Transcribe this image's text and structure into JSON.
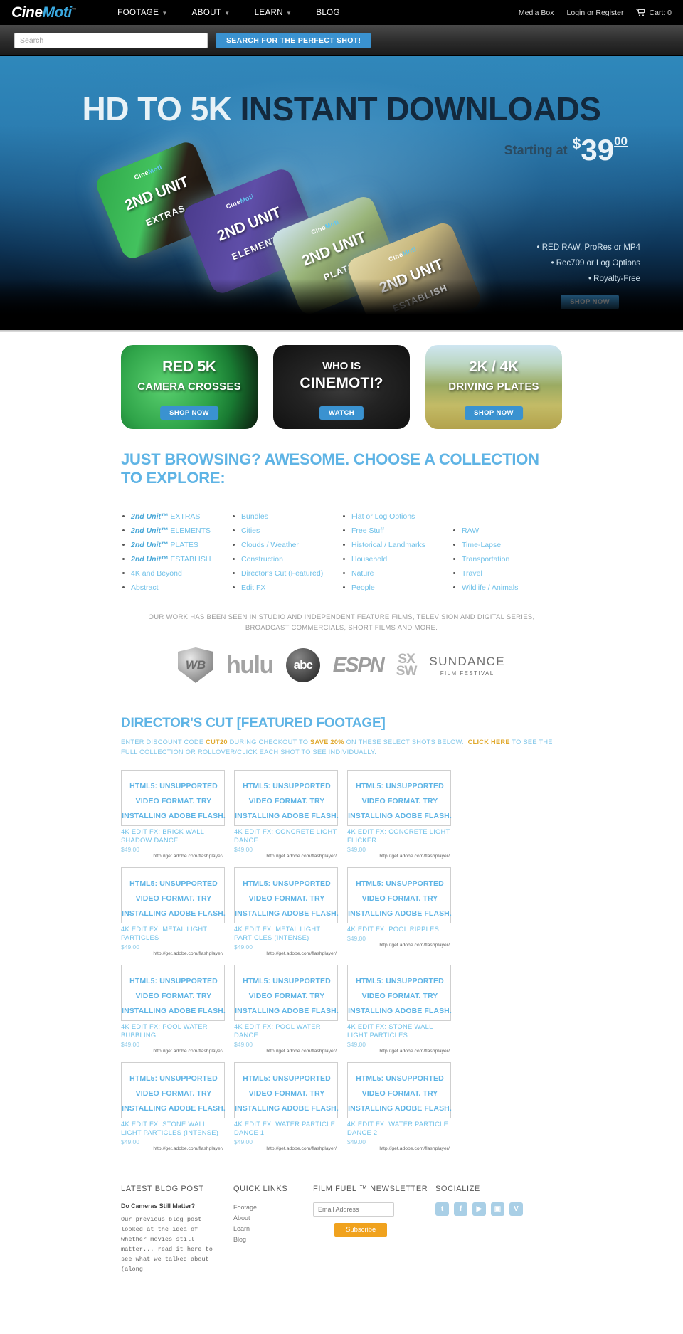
{
  "brand": {
    "part1": "Cine",
    "part2": "Moti",
    "tm": "™"
  },
  "nav": {
    "items": [
      {
        "label": "FOOTAGE",
        "has_caret": true
      },
      {
        "label": "ABOUT",
        "has_caret": true
      },
      {
        "label": "LEARN",
        "has_caret": true
      },
      {
        "label": "BLOG",
        "has_caret": false
      }
    ],
    "media_box": "Media Box",
    "login": "Login or Register",
    "cart": "Cart: 0"
  },
  "search": {
    "placeholder": "Search",
    "value": "",
    "button": "SEARCH FOR THE PERFECT SHOT!"
  },
  "hero": {
    "title_light": "HD TO 5K ",
    "title_dark": "INSTANT DOWNLOADS",
    "starting_at": "Starting at",
    "currency": "$",
    "price": "39",
    "cents": "00",
    "bullets": [
      "• RED RAW, ProRes or MP4",
      "• Rec709 or Log Options",
      "• Royalty-Free"
    ],
    "shop_now": "SHOP NOW",
    "cards": [
      {
        "brand1": "Cine",
        "brand2": "Moti",
        "line1": "2ND UNIT",
        "line2": "EXTRAS"
      },
      {
        "brand1": "Cine",
        "brand2": "Moti",
        "line1": "2ND UNIT",
        "line2": "ELEMENTS"
      },
      {
        "brand1": "Cine",
        "brand2": "Moti",
        "line1": "2ND UNIT",
        "line2": "PLATES"
      },
      {
        "brand1": "Cine",
        "brand2": "Moti",
        "line1": "2ND UNIT",
        "line2": "ESTABLISH"
      }
    ]
  },
  "promos": [
    {
      "title": "RED 5K",
      "sub": "CAMERA CROSSES",
      "button": "SHOP NOW",
      "style": "green"
    },
    {
      "title": "WHO IS",
      "sub": "CINEMOTI?",
      "button": "WATCH",
      "style": "dark"
    },
    {
      "title": "2K / 4K",
      "sub": "DRIVING PLATES",
      "button": "SHOP NOW",
      "style": "field"
    }
  ],
  "browse": {
    "heading": "JUST BROWSING? AWESOME. CHOOSE A COLLECTION TO EXPLORE:",
    "columns": [
      [
        {
          "unit": "2nd Unit™",
          "rest": " EXTRAS"
        },
        {
          "unit": "2nd Unit™",
          "rest": " ELEMENTS"
        },
        {
          "unit": "2nd Unit™",
          "rest": " PLATES"
        },
        {
          "unit": "2nd Unit™",
          "rest": " ESTABLISH"
        },
        {
          "unit": "",
          "rest": "4K and Beyond"
        },
        {
          "unit": "",
          "rest": "Abstract"
        }
      ],
      [
        {
          "unit": "",
          "rest": "Bundles"
        },
        {
          "unit": "",
          "rest": "Cities"
        },
        {
          "unit": "",
          "rest": "Clouds / Weather"
        },
        {
          "unit": "",
          "rest": "Construction"
        },
        {
          "unit": "",
          "rest": "Director's Cut (Featured)"
        },
        {
          "unit": "",
          "rest": "Edit FX"
        }
      ],
      [
        {
          "unit": "",
          "rest": "Flat or Log Options"
        },
        {
          "unit": "",
          "rest": "Free Stuff"
        },
        {
          "unit": "",
          "rest": "Historical / Landmarks"
        },
        {
          "unit": "",
          "rest": "Household"
        },
        {
          "unit": "",
          "rest": "Nature"
        },
        {
          "unit": "",
          "rest": "People"
        }
      ],
      [
        {
          "unit": "",
          "rest": "RAW"
        },
        {
          "unit": "",
          "rest": "Time-Lapse"
        },
        {
          "unit": "",
          "rest": "Transportation"
        },
        {
          "unit": "",
          "rest": "Travel"
        },
        {
          "unit": "",
          "rest": "Wildlife / Animals"
        }
      ]
    ]
  },
  "seen_in": {
    "text": "OUR WORK HAS BEEN SEEN IN STUDIO AND INDEPENDENT FEATURE FILMS, TELEVISION AND DIGITAL SERIES, BROADCAST COMMERCIALS, SHORT FILMS AND MORE.",
    "logos": [
      {
        "name": "warner-bros-tv",
        "text": "WB"
      },
      {
        "name": "hulu",
        "text": "hulu"
      },
      {
        "name": "abc",
        "text": "abc"
      },
      {
        "name": "espn",
        "text": "ESPN"
      },
      {
        "name": "sxsw",
        "line1": "SX",
        "line2": "SW"
      },
      {
        "name": "sundance",
        "line1": "SUNDANCE",
        "line2": "FILM FESTIVAL"
      }
    ]
  },
  "directors_cut": {
    "heading": "DIRECTOR'S CUT [FEATURED FOOTAGE]",
    "sub_a": "ENTER DISCOUNT CODE ",
    "code": "CUT20",
    "sub_b": " DURING CHECKOUT TO ",
    "save": "SAVE 20%",
    "sub_c": " ON THESE SELECT SHOTS BELOW.  ",
    "click_here": "CLICK HERE",
    "sub_d": " TO SEE THE FULL COLLECTION OR ROLLOVER/CLICK EACH SHOT TO SEE INDIVIDUALLY.",
    "fallback_message": "HTML5: UNSUPPORTED VIDEO FORMAT. TRY INSTALLING ADOBE FLASH.",
    "fallback_url": "http://get.adobe.com/flashplayer/",
    "items": [
      {
        "title": "4K EDIT FX: BRICK WALL SHADOW DANCE",
        "price": "$49.00"
      },
      {
        "title": "4K EDIT FX: CONCRETE LIGHT DANCE",
        "price": "$49.00"
      },
      {
        "title": "4K EDIT FX: CONCRETE LIGHT FLICKER",
        "price": "$49.00"
      },
      {
        "title": "4K EDIT FX: METAL LIGHT PARTICLES",
        "price": "$49.00"
      },
      {
        "title": "4K EDIT FX: METAL LIGHT PARTICLES (INTENSE)",
        "price": "$49.00"
      },
      {
        "title": "4K EDIT FX: POOL RIPPLES",
        "price": "$49.00"
      },
      {
        "title": "4K EDIT FX: POOL WATER BUBBLING",
        "price": "$49.00"
      },
      {
        "title": "4K EDIT FX: POOL WATER DANCE",
        "price": "$49.00"
      },
      {
        "title": "4K EDIT FX: STONE WALL LIGHT PARTICLES",
        "price": "$49.00"
      },
      {
        "title": "4K EDIT FX: STONE WALL LIGHT PARTICLES (INTENSE)",
        "price": "$49.00"
      },
      {
        "title": "4K EDIT FX: WATER PARTICLE DANCE 1",
        "price": "$49.00"
      },
      {
        "title": "4K EDIT FX: WATER PARTICLE DANCE 2",
        "price": "$49.00"
      }
    ]
  },
  "footer": {
    "blog_heading": "LATEST BLOG POST",
    "blog_title": "Do Cameras Still Matter?",
    "blog_body": "Our previous blog post looked at the idea of whether movies still matter... read it here to see what we talked about (along",
    "quick_heading": "QUICK LINKS",
    "quick_links": [
      "Footage",
      "About",
      "Learn",
      "Blog"
    ],
    "news_heading": "FILM FUEL ™ NEWSLETTER",
    "news_placeholder": "Email Address",
    "news_value": "",
    "subscribe": "Subscribe",
    "social_heading": "SOCIALIZE",
    "socials": [
      {
        "name": "twitter-icon",
        "glyph": "t"
      },
      {
        "name": "facebook-icon",
        "glyph": "f"
      },
      {
        "name": "youtube-icon",
        "glyph": "▶"
      },
      {
        "name": "instagram-icon",
        "glyph": "▣"
      },
      {
        "name": "vimeo-icon",
        "glyph": "V"
      }
    ]
  },
  "colors": {
    "accent": "#3a92d0",
    "link": "#6fc0e8",
    "heading": "#5fb4e5",
    "gold": "#e0a92e",
    "subscribe": "#f0a21e"
  }
}
